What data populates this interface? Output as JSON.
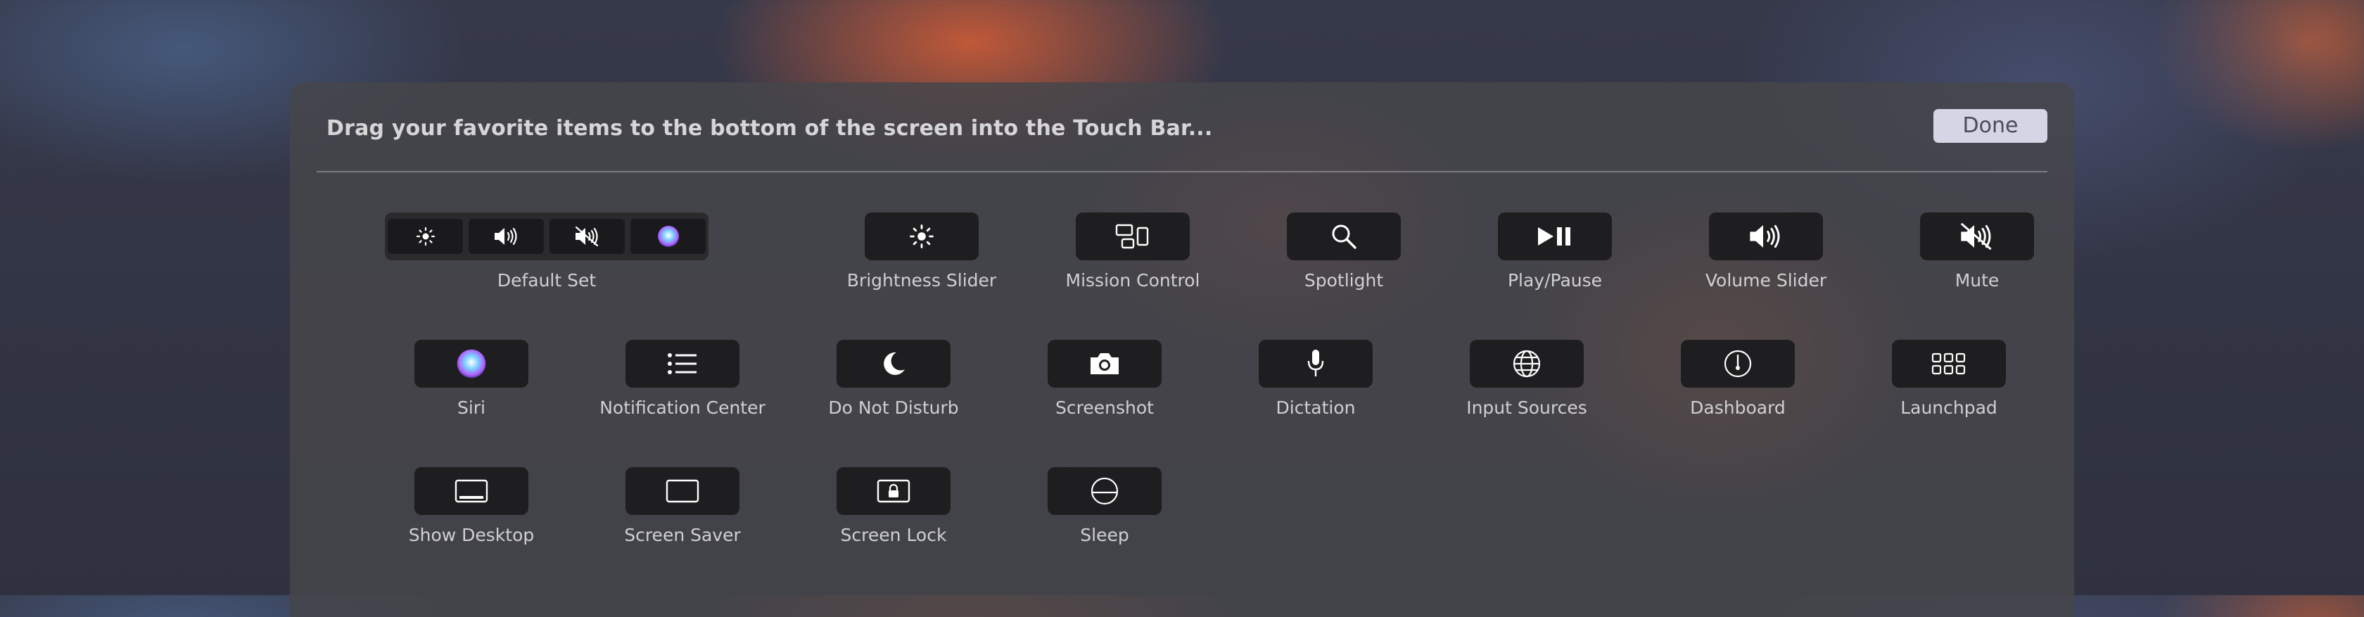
{
  "header": {
    "title": "Drag your favorite items to the bottom of the screen into the Touch Bar...",
    "done_label": "Done"
  },
  "items": [
    {
      "label": "Default Set",
      "icons": [
        "brightness-icon",
        "volume-icon",
        "mute-icon",
        "siri-icon"
      ]
    },
    {
      "label": "Brightness Slider",
      "icon": "brightness-icon"
    },
    {
      "label": "Mission Control",
      "icon": "mission-control-icon"
    },
    {
      "label": "Spotlight",
      "icon": "search-icon"
    },
    {
      "label": "Play/Pause",
      "icon": "play-pause-icon"
    },
    {
      "label": "Volume Slider",
      "icon": "volume-icon"
    },
    {
      "label": "Mute",
      "icon": "mute-icon"
    },
    {
      "label": "Siri",
      "icon": "siri-icon"
    },
    {
      "label": "Notification Center",
      "icon": "list-icon"
    },
    {
      "label": "Do Not Disturb",
      "icon": "moon-icon"
    },
    {
      "label": "Screenshot",
      "icon": "camera-icon"
    },
    {
      "label": "Dictation",
      "icon": "microphone-icon"
    },
    {
      "label": "Input Sources",
      "icon": "globe-icon"
    },
    {
      "label": "Dashboard",
      "icon": "gauge-icon"
    },
    {
      "label": "Launchpad",
      "icon": "grid-icon"
    },
    {
      "label": "Show Desktop",
      "icon": "desktop-icon"
    },
    {
      "label": "Screen Saver",
      "icon": "screen-saver-icon"
    },
    {
      "label": "Screen Lock",
      "icon": "lock-icon"
    },
    {
      "label": "Sleep",
      "icon": "sleep-icon"
    }
  ],
  "colors": {
    "panel": "#464649",
    "key": "#1e1e20",
    "done_button": "#d4d6e6",
    "label_text": "#d0d0d2"
  }
}
